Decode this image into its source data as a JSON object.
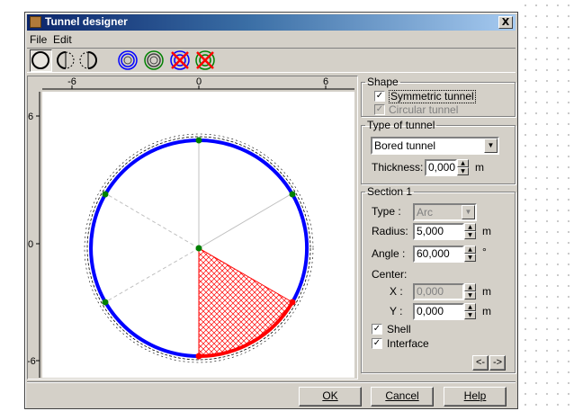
{
  "window": {
    "title": "Tunnel designer",
    "close_label": "X"
  },
  "menu": {
    "file": "File",
    "edit": "Edit"
  },
  "toolbar": {
    "icons": [
      "circle-shape-icon",
      "half-circle-shape-icon",
      "half-circle-right-shape-icon",
      "blue-rings-icon",
      "green-rings-icon",
      "delete-blue-icon",
      "delete-green-icon"
    ]
  },
  "plot": {
    "x_ticks": [
      "-6",
      "0",
      "6"
    ],
    "y_ticks": [
      "6",
      "0",
      "-6"
    ],
    "radius": 5,
    "colors": {
      "shell": "#0000ff",
      "section": "#ff0000",
      "nodes": "#008000"
    }
  },
  "shape": {
    "legend": "Shape",
    "symmetric_label": "Symmetric tunnel",
    "symmetric_checked": true,
    "circular_label": "Circular tunnel",
    "circular_checked": true
  },
  "tunnel_type": {
    "legend": "Type of tunnel",
    "value": "Bored tunnel",
    "thickness_label": "Thickness:",
    "thickness_value": "0,000",
    "thickness_unit": "m"
  },
  "section": {
    "legend": "Section 1",
    "type_label": "Type :",
    "type_value": "Arc",
    "radius_label": "Radius:",
    "radius_value": "5,000",
    "radius_unit": "m",
    "angle_label": "Angle :",
    "angle_value": "60,000",
    "angle_unit": "°",
    "center_label": "Center:",
    "x_label": "X :",
    "x_value": "0,000",
    "x_unit": "m",
    "y_label": "Y :",
    "y_value": "0,000",
    "y_unit": "m",
    "shell_label": "Shell",
    "shell_checked": true,
    "interface_label": "Interface",
    "interface_checked": true,
    "prev_label": "<-",
    "next_label": "->"
  },
  "buttons": {
    "ok": "OK",
    "cancel": "Cancel",
    "help": "Help"
  }
}
